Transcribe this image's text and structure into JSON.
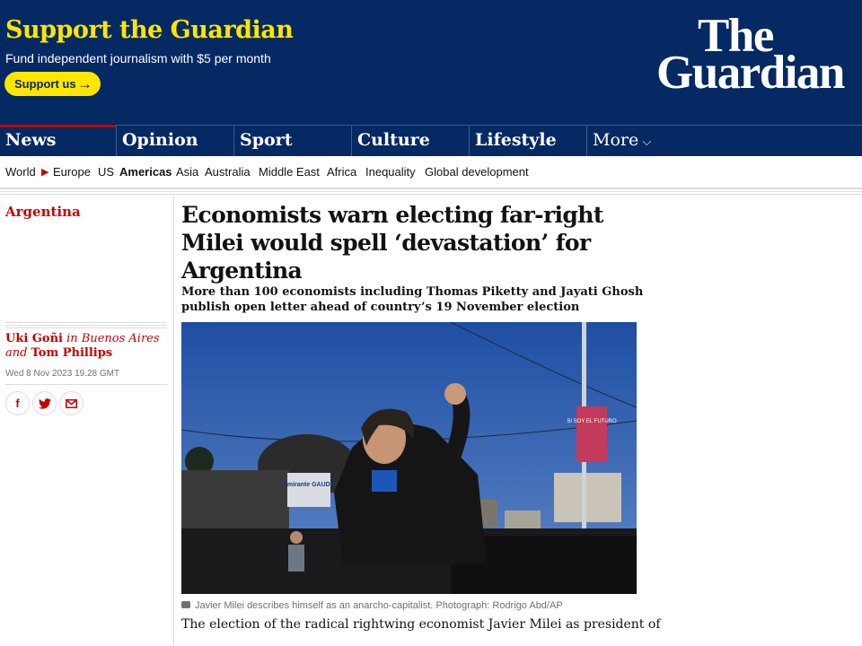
{
  "support": {
    "title": "Support the Guardian",
    "subtitle": "Fund independent journalism with $5 per month",
    "button": "Support us",
    "button_icon": "arrow-right-icon"
  },
  "logo": {
    "line1": "The",
    "line2": "Guardian"
  },
  "pillars": [
    {
      "label": "News"
    },
    {
      "label": "Opinion"
    },
    {
      "label": "Sport"
    },
    {
      "label": "Culture"
    },
    {
      "label": "Lifestyle"
    },
    {
      "label": "More"
    }
  ],
  "subnav": {
    "items": [
      "World",
      "Europe",
      "US",
      "Americas",
      "Asia",
      "Australia",
      "Middle East",
      "Africa",
      "Inequality",
      "Global development"
    ]
  },
  "article": {
    "section": "Argentina",
    "headline": "Economists warn electing far-right Milei would spell ‘devastation’ for Argentina",
    "standfirst": "More than 100 economists including Thomas Piketty and Jayati Ghosh publish open letter ahead of country’s 19 November election",
    "byline": {
      "author1": "Uki Goñi",
      "location": "in Buenos Aires",
      "and": "and",
      "author2": "Tom Phillips"
    },
    "date": "Wed 8 Nov 2023 19.28 GMT",
    "share": [
      "facebook-icon",
      "twitter-icon",
      "email-icon"
    ],
    "photo": {
      "sign_text": "Almirante GAUDIO",
      "banner_text": "SI SOY EL FUTURO"
    },
    "caption": "Javier Milei describes himself as an anarcho-capitalist. Photograph: Rodrigo Abd/AP",
    "body": "The election of the radical rightwing economist Javier Milei as president of"
  },
  "colors": {
    "brand_blue": "#052962",
    "support_yellow": "#ffe500",
    "news_red": "#c70000"
  }
}
